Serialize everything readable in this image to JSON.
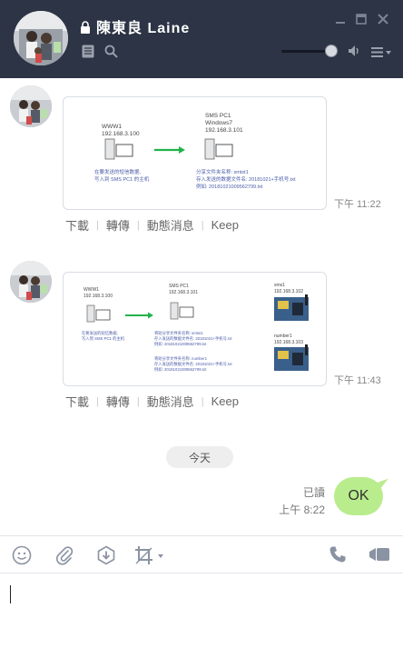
{
  "header": {
    "contact_name": "陳東良 Laine",
    "icons": [
      "lock-icon",
      "notes-icon",
      "search-icon",
      "minimize-icon",
      "maximize-icon",
      "close-icon",
      "volume-icon",
      "menu-icon"
    ],
    "volume_level": 0.85,
    "colors": {
      "background": "#2c3445",
      "text": "#ffffff"
    }
  },
  "messages": [
    {
      "type": "image",
      "time": "下午 11:22",
      "image_text": {
        "left_host": "WWW1",
        "left_ip": "192.168.3.100",
        "right_host": "SMS PC1",
        "right_os": "Windows7",
        "right_ip": "192.168.3.101",
        "left_caption_1": "在要发送的短信数据,",
        "left_caption_2": "写入到 SMS PC1 的主机",
        "right_caption_1": "分享文件夹名称: smtxt1",
        "right_caption_2": "存入发送的数据文件名: 20181021+手机号.txt",
        "right_caption_3": "例如: 20181021009562799.txt"
      },
      "actions": [
        "下載",
        "轉傳",
        "動態消息",
        "Keep"
      ]
    },
    {
      "type": "image",
      "time": "下午 11:43",
      "image_text": {
        "left_host": "WWW1",
        "left_ip": "192.168.3.100",
        "mid_host": "SMS PC1",
        "mid_ip": "192.168.3.101",
        "left_caption_1": "在要发送的短信数据,",
        "left_caption_2": "写入到 SMS PC1 的主机",
        "mid_caption_1": "将短分享文件夹名称: smtxt1",
        "mid_caption_2": "存入发送的数据文件名: 20181021+手机号.txt",
        "mid_caption_3": "例如: 20181021009562799.txt",
        "mid_caption_4": "将短分享文件夹名称: number1",
        "mid_caption_5": "存入发送的数据文件名: 20181021+手机号.txt",
        "mid_caption_6": "例如: 20181021009562799.txt",
        "right_top_label": "sms1",
        "right_top_ip": "192.168.3.102",
        "right_bottom_label": "number1",
        "right_bottom_ip": "192.168.3.103"
      },
      "actions": [
        "下載",
        "轉傳",
        "動態消息",
        "Keep"
      ]
    }
  ],
  "date_divider": "今天",
  "sent": {
    "text": "OK",
    "status": "已讀",
    "time": "上午 8:22",
    "bubble_color": "#b9ec8d"
  },
  "toolbar": {
    "icons": [
      "emoji-icon",
      "attachment-icon",
      "download-box-icon",
      "crop-icon",
      "phone-icon",
      "video-call-icon"
    ]
  },
  "input": {
    "value": "",
    "placeholder": ""
  }
}
